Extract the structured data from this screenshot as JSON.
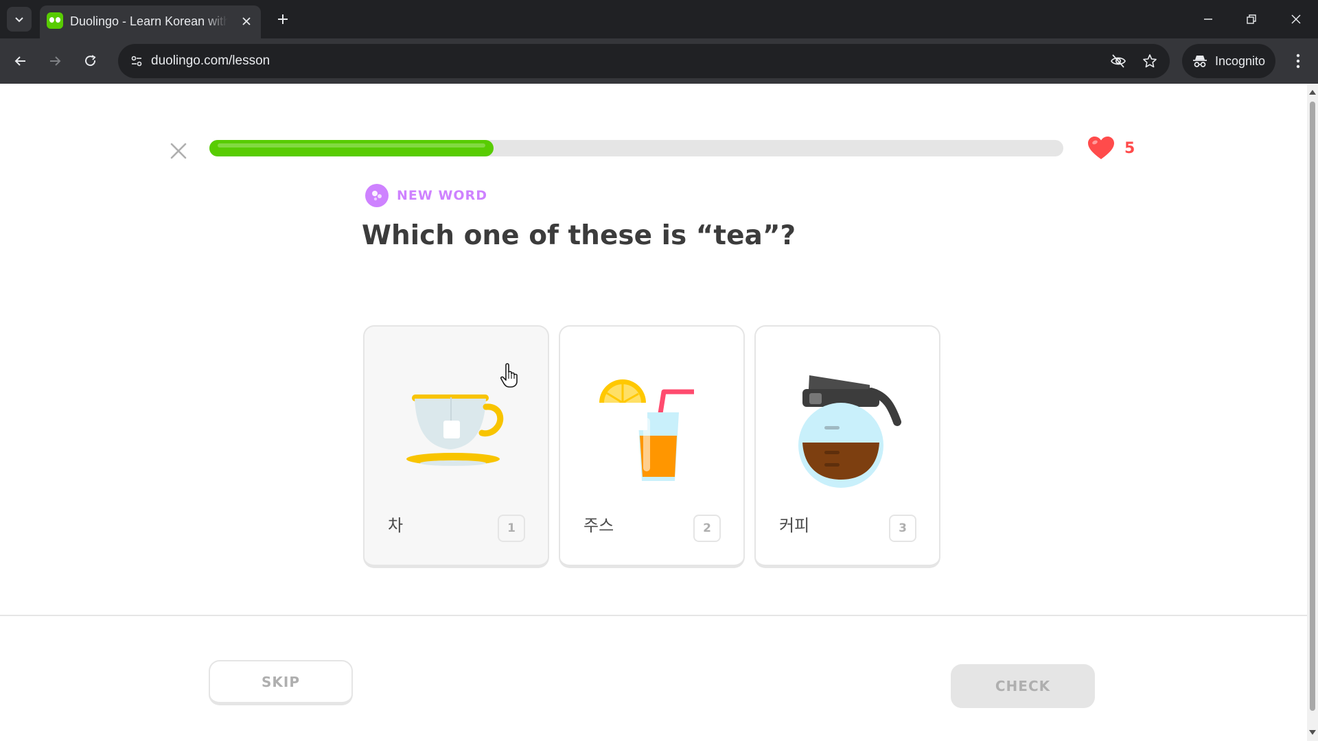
{
  "browser": {
    "tab_title": "Duolingo - Learn Korean with lessons",
    "url": "duolingo.com/lesson",
    "incognito_label": "Incognito",
    "icons": [
      "tab-list-icon",
      "duolingo-favicon-icon",
      "close-icon",
      "plus-icon",
      "minimize-icon",
      "restore-icon",
      "close-window-icon",
      "back-arrow-icon",
      "forward-arrow-icon",
      "reload-icon",
      "site-info-icon",
      "eye-off-icon",
      "star-icon",
      "incognito-icon",
      "more-vert-icon"
    ]
  },
  "lesson": {
    "progress": 0.333,
    "hearts": "5",
    "badge": "NEW WORD",
    "question": "Which one of these is “tea”?",
    "choices": [
      {
        "text": "차",
        "key": "1",
        "image": "tea-cup-icon",
        "hovered": true
      },
      {
        "text": "주스",
        "key": "2",
        "image": "juice-glass-icon",
        "hovered": false
      },
      {
        "text": "커피",
        "key": "3",
        "image": "coffee-pot-icon",
        "hovered": false
      }
    ],
    "skip_label": "SKIP",
    "check_label": "CHECK"
  },
  "colors": {
    "progress_fill": "#58cc02",
    "heart": "#ff4b4b",
    "badge": "#ce82ff"
  }
}
